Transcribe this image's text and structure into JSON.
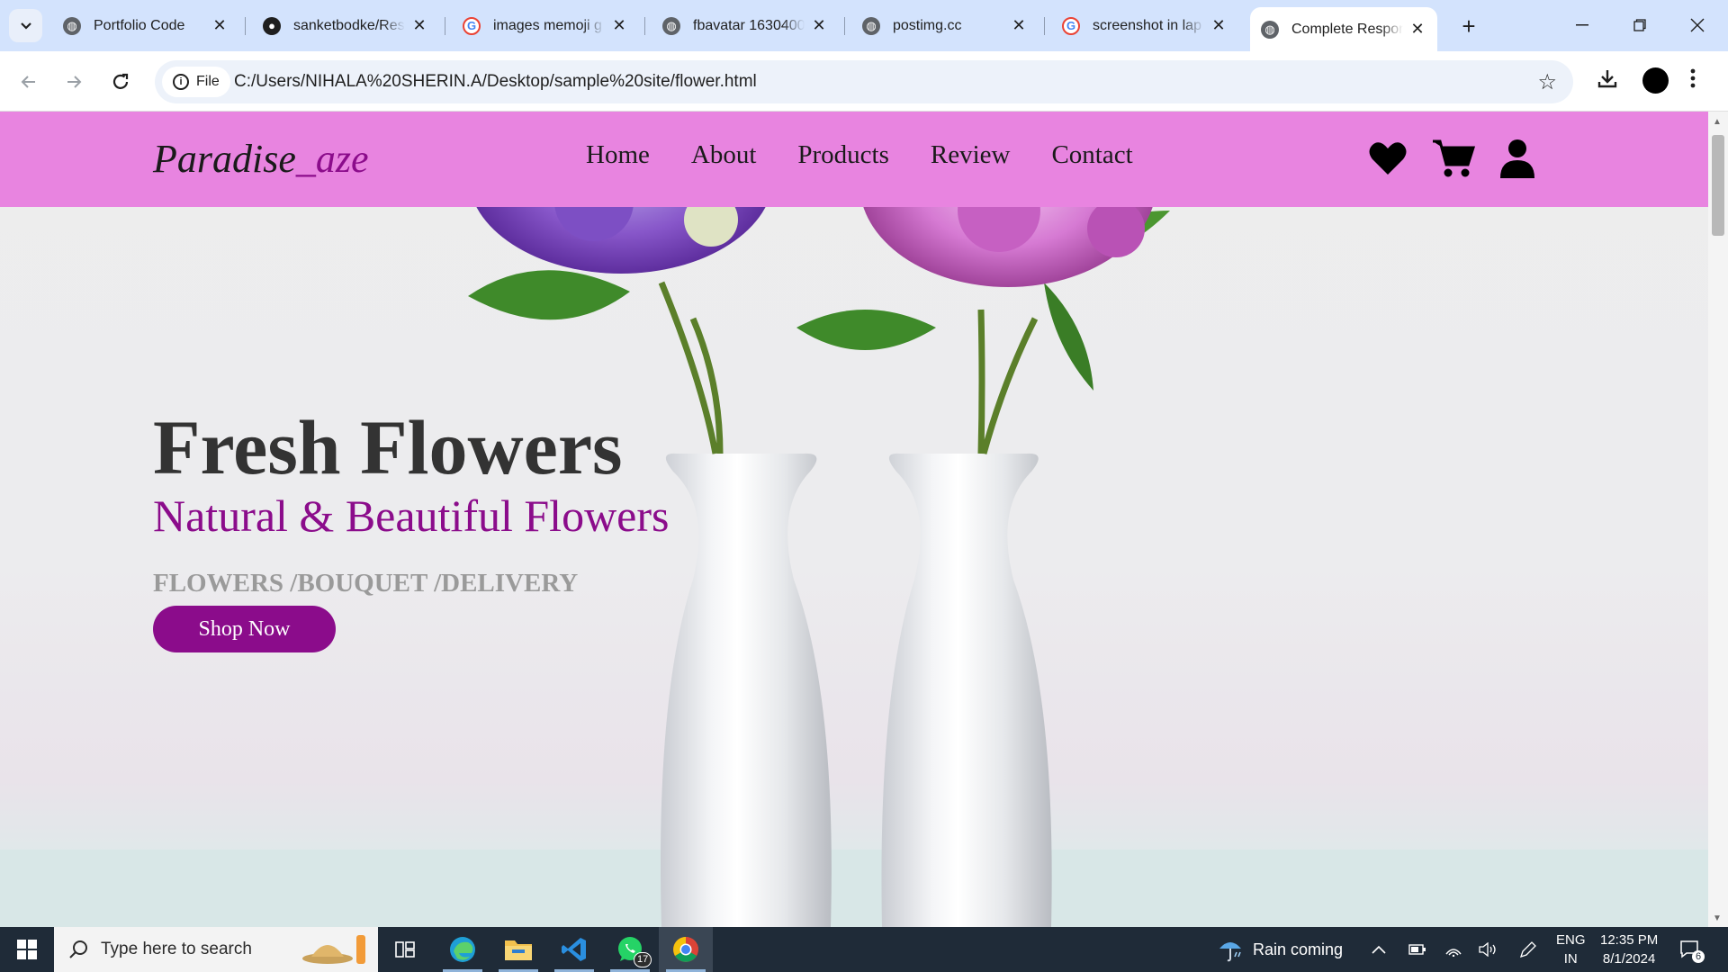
{
  "browser": {
    "tabs": [
      {
        "title": "Portfolio Code",
        "icon": "globe-icon"
      },
      {
        "title": "sanketbodke/Res",
        "icon": "github-icon"
      },
      {
        "title": "images memoji g",
        "icon": "google-icon"
      },
      {
        "title": "fbavatar 1630400",
        "icon": "globe-icon"
      },
      {
        "title": "postimg.cc",
        "icon": "globe-icon"
      },
      {
        "title": "screenshot in lap",
        "icon": "google-icon"
      },
      {
        "title": "Complete Respon",
        "icon": "globe-icon",
        "active": true
      }
    ],
    "site_info_label": "File",
    "url": "C:/Users/NIHALA%20SHERIN.A/Desktop/sample%20site/flower.html"
  },
  "site": {
    "logo_main": "Paradise",
    "logo_accent": "_aze",
    "nav": [
      "Home",
      "About",
      "Products",
      "Review",
      "Contact"
    ],
    "header_icons": [
      "heart-icon",
      "cart-icon",
      "user-icon"
    ],
    "hero": {
      "title": "Fresh Flowers",
      "subtitle": "Natural & Beautiful Flowers",
      "tagline": "FLOWERS /BOUQUET /DELIVERY",
      "button": "Shop Now"
    },
    "colors": {
      "header_bg": "#e884e0",
      "accent": "#8b0c8b"
    }
  },
  "taskbar": {
    "search_placeholder": "Type here to search",
    "whatsapp_badge": "17",
    "weather": "Rain coming",
    "lang_1": "ENG",
    "lang_2": "IN",
    "time": "12:35 PM",
    "date": "8/1/2024",
    "notifications": "6"
  }
}
